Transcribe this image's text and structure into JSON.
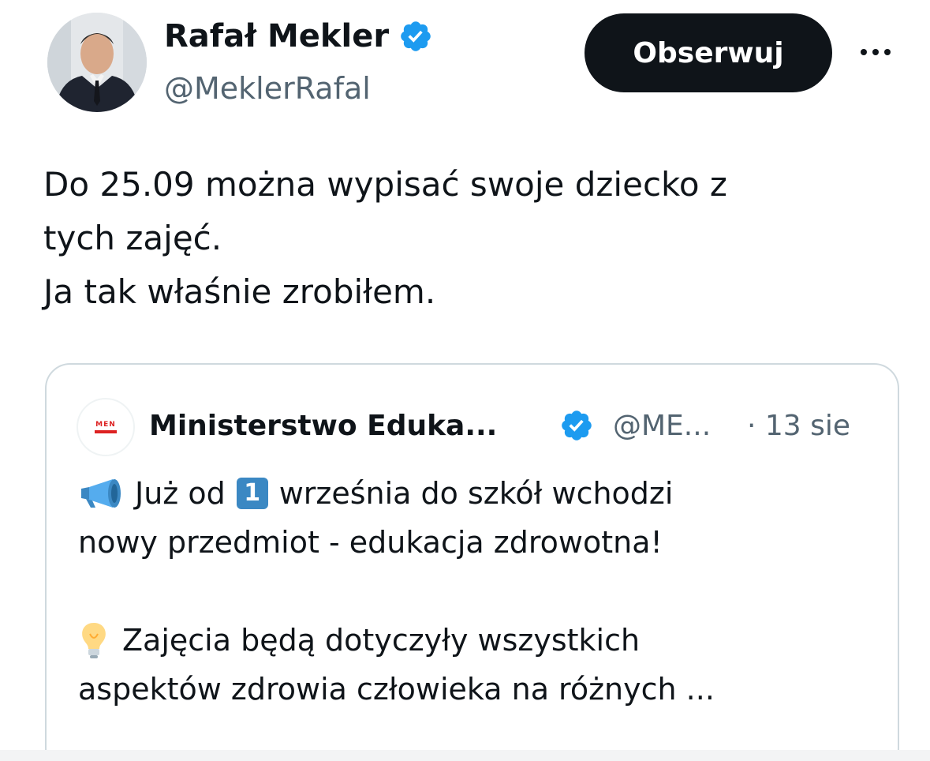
{
  "author": {
    "name": "Rafał Mekler",
    "handle": "@MeklerRafal",
    "verified": true
  },
  "follow_button": {
    "label": "Obserwuj"
  },
  "more_button": {
    "icon": "more-horizontal-icon"
  },
  "tweet": {
    "lines": [
      "Do 25.09 można wypisać swoje dziecko z",
      "tych zajęć.",
      "Ja tak właśnie zrobiłem."
    ]
  },
  "quoted": {
    "name": "Ministerstwo Eduka...",
    "handle": "@ME...",
    "date": "· 13 sie",
    "verified": true,
    "avatar_text": "MEN",
    "body": {
      "line1_a": "Już od",
      "keycap": "1",
      "line1_b": "września do szkół wchodzi",
      "line2": "nowy przedmiot - edukacja zdrowotna!",
      "line3": "Zajęcia będą dotyczyły wszystkich",
      "line4": "aspektów zdrowia człowieka na różnych ..."
    }
  },
  "colors": {
    "text": "#0f1419",
    "secondary": "#536471",
    "verified": "#1d9bf0",
    "button_bg": "#0f1419",
    "border": "#cfd9de"
  }
}
